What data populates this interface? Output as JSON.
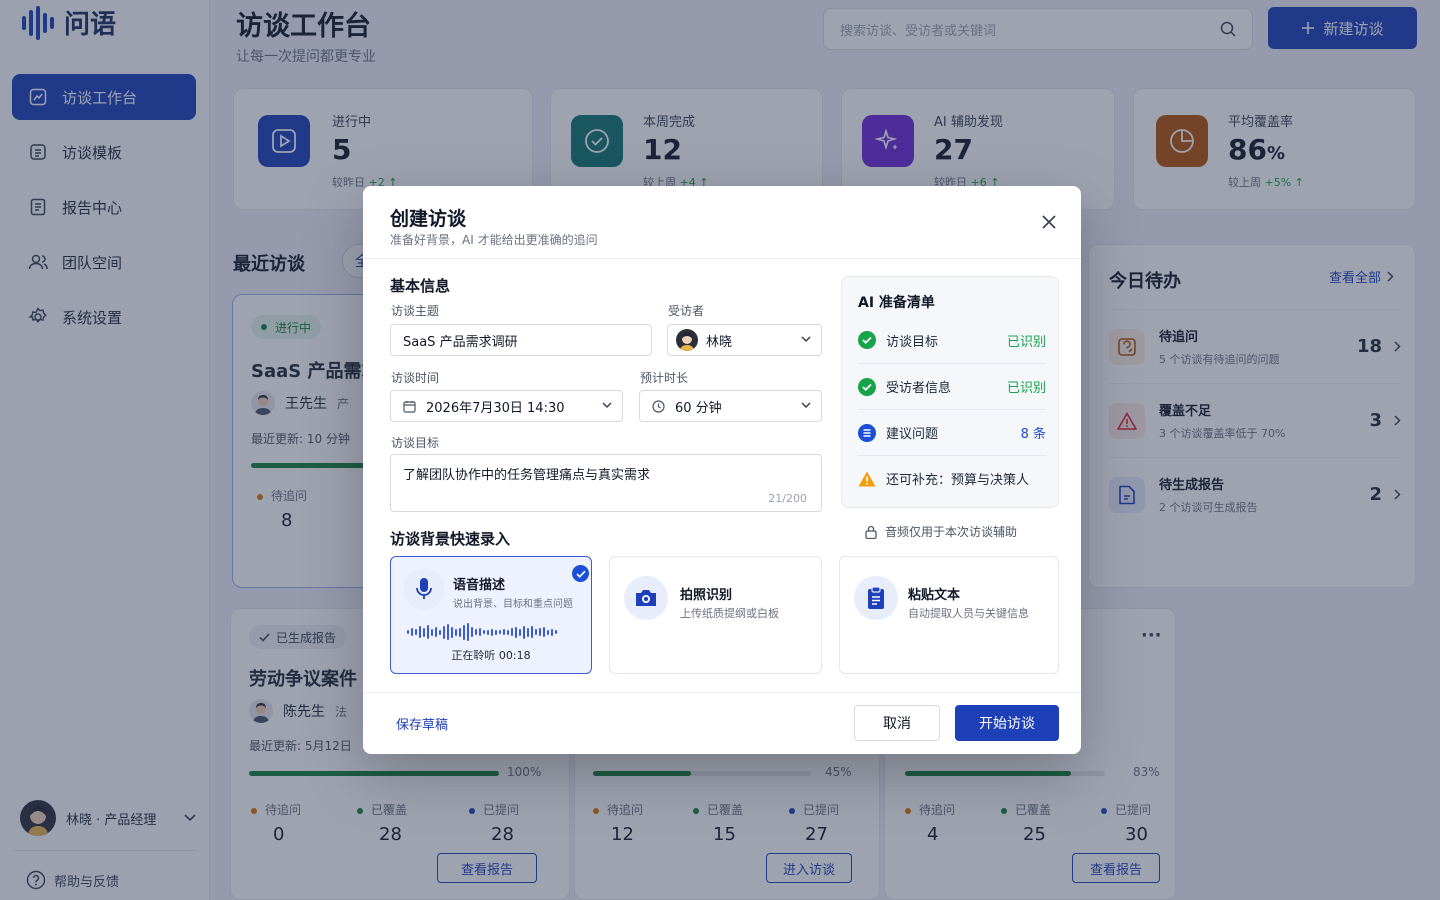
{
  "app": {
    "name": "问语"
  },
  "sidebar": {
    "items": [
      {
        "label": "访谈工作台",
        "icon": "workbench-icon",
        "active": true
      },
      {
        "label": "访谈模板",
        "icon": "template-icon"
      },
      {
        "label": "报告中心",
        "icon": "report-icon"
      },
      {
        "label": "团队空间",
        "icon": "team-icon"
      },
      {
        "label": "系统设置",
        "icon": "settings-icon"
      }
    ],
    "user": "林晓 · 产品经理",
    "help": "帮助与反馈"
  },
  "header": {
    "title": "访谈工作台",
    "subtitle": "让每一次提问都更专业",
    "search_placeholder": "搜索访谈、受访者或关键词",
    "new_button": "新建访谈"
  },
  "stats": [
    {
      "label": "进行中",
      "value": "5",
      "unit": "",
      "delta_label": "较昨日",
      "delta": "+2",
      "color": "#1d3fb8"
    },
    {
      "label": "本周完成",
      "value": "12",
      "unit": "",
      "delta_label": "较上周",
      "delta": "+4",
      "color": "#0f766e"
    },
    {
      "label": "AI 辅助发现",
      "value": "27",
      "unit": "",
      "delta_label": "较昨日",
      "delta": "+6",
      "color": "#6d28d9"
    },
    {
      "label": "平均覆盖率",
      "value": "86",
      "unit": "%",
      "delta_label": "较上周",
      "delta": "+5%",
      "color": "#b45309"
    }
  ],
  "recent": {
    "title": "最近访谈",
    "filter_initial": "全",
    "card1": {
      "status": "进行中",
      "title": "SaaS 产品需求",
      "person": "王先生",
      "tag": "产",
      "updated": "最近更新:  10 分钟",
      "metric_label": "待追问",
      "metric_value": "8"
    },
    "card2": {
      "status": "已生成报告",
      "title": "劳动争议案件",
      "person": "陈先生",
      "tag": "法",
      "updated": "最近更新:  5月12日",
      "progress": 100,
      "progress_label": "100%",
      "metrics": [
        {
          "label": "待追问",
          "value": "0"
        },
        {
          "label": "已覆盖",
          "value": "28"
        },
        {
          "label": "已提问",
          "value": "28"
        }
      ],
      "button": "查看报告"
    },
    "card3": {
      "progress": 45,
      "progress_label": "45%",
      "metrics": [
        {
          "label": "待追问",
          "value": "12"
        },
        {
          "label": "已覆盖",
          "value": "15"
        },
        {
          "label": "已提问",
          "value": "27"
        }
      ],
      "button": "进入访谈"
    },
    "card4": {
      "more": "···",
      "progress": 83,
      "progress_label": "83%",
      "metrics": [
        {
          "label": "待追问",
          "value": "4"
        },
        {
          "label": "已覆盖",
          "value": "25"
        },
        {
          "label": "已提问",
          "value": "30"
        }
      ],
      "button": "查看报告"
    }
  },
  "todo": {
    "title": "今日待办",
    "view_all": "查看全部",
    "items": [
      {
        "title": "待追问",
        "desc": "5 个访谈有待追问的问题",
        "count": "18",
        "color": "#b45309",
        "bg": "#fdf1e3"
      },
      {
        "title": "覆盖不足",
        "desc": "3 个访谈覆盖率低于 70%",
        "count": "3",
        "color": "#dc2626",
        "bg": "#fde8e8"
      },
      {
        "title": "待生成报告",
        "desc": "2 个访谈可生成报告",
        "count": "2",
        "color": "#1d3fb8",
        "bg": "#e6ecfb"
      }
    ]
  },
  "modal": {
    "title": "创建访谈",
    "subtitle": "准备好背景，AI 才能给出更准确的追问",
    "basic_title": "基本信息",
    "topic_label": "访谈主题",
    "topic_value": "SaaS 产品需求调研",
    "interviewee_label": "受访者",
    "interviewee_value": "林晓",
    "time_label": "访谈时间",
    "time_value": "2026年7月30日 14:30",
    "duration_label": "预计时长",
    "duration_value": "60 分钟",
    "goal_label": "访谈目标",
    "goal_value": "了解团队协作中的任务管理痛点与真实需求",
    "goal_count": "21/200",
    "quick_title": "访谈背景快速录入",
    "quick_items": [
      {
        "title": "语音描述",
        "desc": "说出背景、目标和重点问题",
        "status": "正在聆听  00:18",
        "icon": "microphone-icon"
      },
      {
        "title": "拍照识别",
        "desc": "上传纸质提纲或白板",
        "icon": "camera-icon"
      },
      {
        "title": "粘贴文本",
        "desc": "自动提取人员与关键信息",
        "icon": "clipboard-icon"
      }
    ],
    "ai": {
      "title": "AI 准备清单",
      "items": [
        {
          "label": "访谈目标",
          "status": "已识别",
          "kind": "ok"
        },
        {
          "label": "受访者信息",
          "status": "已识别",
          "kind": "ok"
        },
        {
          "label": "建议问题",
          "status": "8 条",
          "kind": "info"
        },
        {
          "label": "还可补充：预算与决策人",
          "status": "",
          "kind": "warn"
        }
      ],
      "privacy": "音频仅用于本次访谈辅助"
    },
    "save_draft": "保存草稿",
    "cancel": "取消",
    "start": "开始访谈"
  }
}
